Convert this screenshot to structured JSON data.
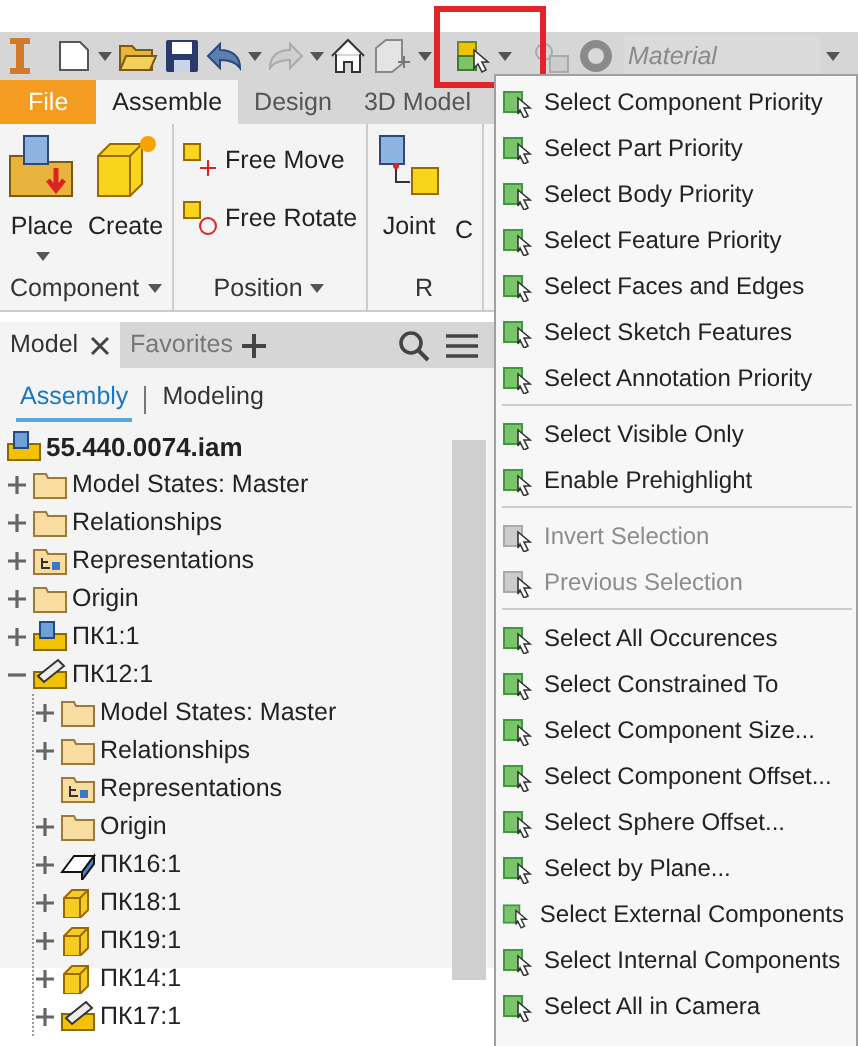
{
  "toolbar": {
    "material": {
      "placeholder": "Material"
    }
  },
  "ribbon": {
    "tabs": [
      {
        "label": "File",
        "kind": "file",
        "selected": false
      },
      {
        "label": "Assemble",
        "kind": "tab",
        "selected": true
      },
      {
        "label": "Design",
        "kind": "tab",
        "selected": false
      },
      {
        "label": "3D Model",
        "kind": "tab",
        "selected": false
      }
    ],
    "panels": [
      {
        "title": "Component",
        "dropdown": true,
        "buttons": [
          {
            "label": "Place",
            "kind": "place",
            "dropdown": true
          },
          {
            "label": "Create",
            "kind": "create",
            "dropdown": false
          }
        ]
      },
      {
        "title": "Position",
        "dropdown": true,
        "small_buttons": [
          {
            "label": "Free Move",
            "kind": "move"
          },
          {
            "label": "Free Rotate",
            "kind": "rotate"
          }
        ]
      },
      {
        "title": "R",
        "dropdown": false,
        "buttons": [
          {
            "label": "Joint",
            "kind": "joint",
            "dropdown": false
          },
          {
            "label": "C",
            "kind": "none",
            "dropdown": false
          }
        ]
      }
    ]
  },
  "browser": {
    "tabs": [
      {
        "label": "Model",
        "selected": true,
        "closable": true
      },
      {
        "label": "Favorites",
        "selected": false,
        "closable": false
      }
    ],
    "modes": [
      {
        "label": "Assembly",
        "selected": true
      },
      {
        "label": "Modeling",
        "selected": false
      }
    ],
    "tree": [
      {
        "label": "55.440.0074.iam",
        "kind": "assembly",
        "children": [
          {
            "label": "Model States: Master",
            "kind": "folder",
            "expanded": false
          },
          {
            "label": "Relationships",
            "kind": "folder",
            "expanded": false
          },
          {
            "label": "Representations",
            "kind": "representations",
            "expanded": false
          },
          {
            "label": "Origin",
            "kind": "folder",
            "expanded": false
          },
          {
            "label": "ПК1:1",
            "kind": "assembly",
            "expanded": false
          },
          {
            "label": "ПК12:1",
            "kind": "weldment",
            "expanded": true,
            "children": [
              {
                "label": "Model States: Master",
                "kind": "folder",
                "expanded": false
              },
              {
                "label": "Relationships",
                "kind": "folder",
                "expanded": false
              },
              {
                "label": "Representations",
                "kind": "representations"
              },
              {
                "label": "Origin",
                "kind": "folder",
                "expanded": false
              },
              {
                "label": "ПК16:1",
                "kind": "sheet",
                "expanded": false
              },
              {
                "label": "ПК18:1",
                "kind": "part",
                "expanded": false
              },
              {
                "label": "ПК19:1",
                "kind": "part",
                "expanded": false
              },
              {
                "label": "ПК14:1",
                "kind": "part",
                "expanded": false
              },
              {
                "label": "ПК17:1",
                "kind": "weldment",
                "expanded": false
              }
            ]
          }
        ]
      }
    ]
  },
  "selection_menu": {
    "groups": [
      [
        {
          "label": "Select Component Priority",
          "disabled": false
        },
        {
          "label": "Select Part Priority",
          "disabled": false
        },
        {
          "label": "Select Body Priority",
          "disabled": false
        },
        {
          "label": "Select Feature Priority",
          "disabled": false
        },
        {
          "label": "Select Faces and Edges",
          "disabled": false
        },
        {
          "label": "Select Sketch Features",
          "disabled": false
        },
        {
          "label": "Select Annotation Priority",
          "disabled": false
        }
      ],
      [
        {
          "label": "Select Visible Only",
          "disabled": false
        },
        {
          "label": "Enable Prehighlight",
          "disabled": false
        }
      ],
      [
        {
          "label": "Invert Selection",
          "disabled": true
        },
        {
          "label": "Previous Selection",
          "disabled": true
        }
      ],
      [
        {
          "label": "Select All Occurences",
          "disabled": false
        },
        {
          "label": "Select Constrained To",
          "disabled": false
        },
        {
          "label": "Select Component Size...",
          "disabled": false
        },
        {
          "label": "Select Component Offset...",
          "disabled": false
        },
        {
          "label": "Select Sphere Offset...",
          "disabled": false
        },
        {
          "label": "Select by Plane...",
          "disabled": false
        },
        {
          "label": "Select External Components",
          "disabled": false
        },
        {
          "label": "Select Internal Components",
          "disabled": false
        },
        {
          "label": "Select All in Camera",
          "disabled": false
        }
      ]
    ]
  }
}
